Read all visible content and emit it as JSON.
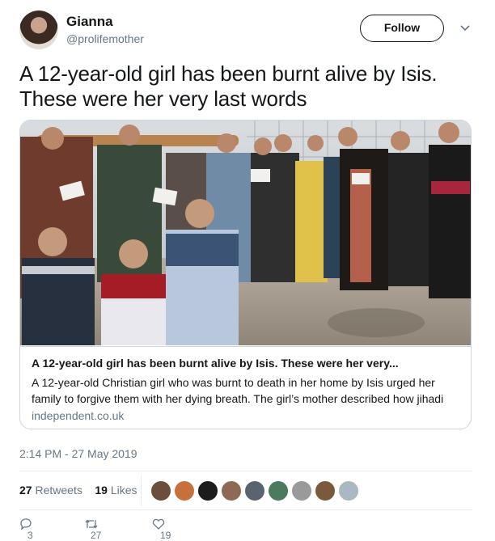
{
  "user": {
    "display_name": "Gianna",
    "handle": "@prolifemother",
    "follow_label": "Follow"
  },
  "tweet": {
    "text": "A 12-year-old girl has been burnt alive by Isis. These were her very last words",
    "timestamp": "2:14 PM - 27 May 2019"
  },
  "card": {
    "title": "A 12-year-old girl has been burnt alive by Isis. These were her very...",
    "description": "A 12-year-old Christian girl who was burnt to death in her home by Isis urged her family to forgive them with her dying breath.  The girl’s mother described how jihadi",
    "domain": "independent.co.uk"
  },
  "stats": {
    "retweets_count": "27",
    "retweets_label": "Retweets",
    "likes_count": "19",
    "likes_label": "Likes"
  },
  "likers": [
    {
      "color": "#6b4f3a"
    },
    {
      "color": "#c8703c"
    },
    {
      "color": "#1c1c1c"
    },
    {
      "color": "#8e6a55"
    },
    {
      "color": "#5a6470"
    },
    {
      "color": "#4c7a5e"
    },
    {
      "color": "#9a9a9a"
    },
    {
      "color": "#7a5a3a"
    },
    {
      "color": "#aab8c2"
    }
  ],
  "actions": {
    "replies": "3",
    "retweets": "27",
    "likes": "19"
  }
}
